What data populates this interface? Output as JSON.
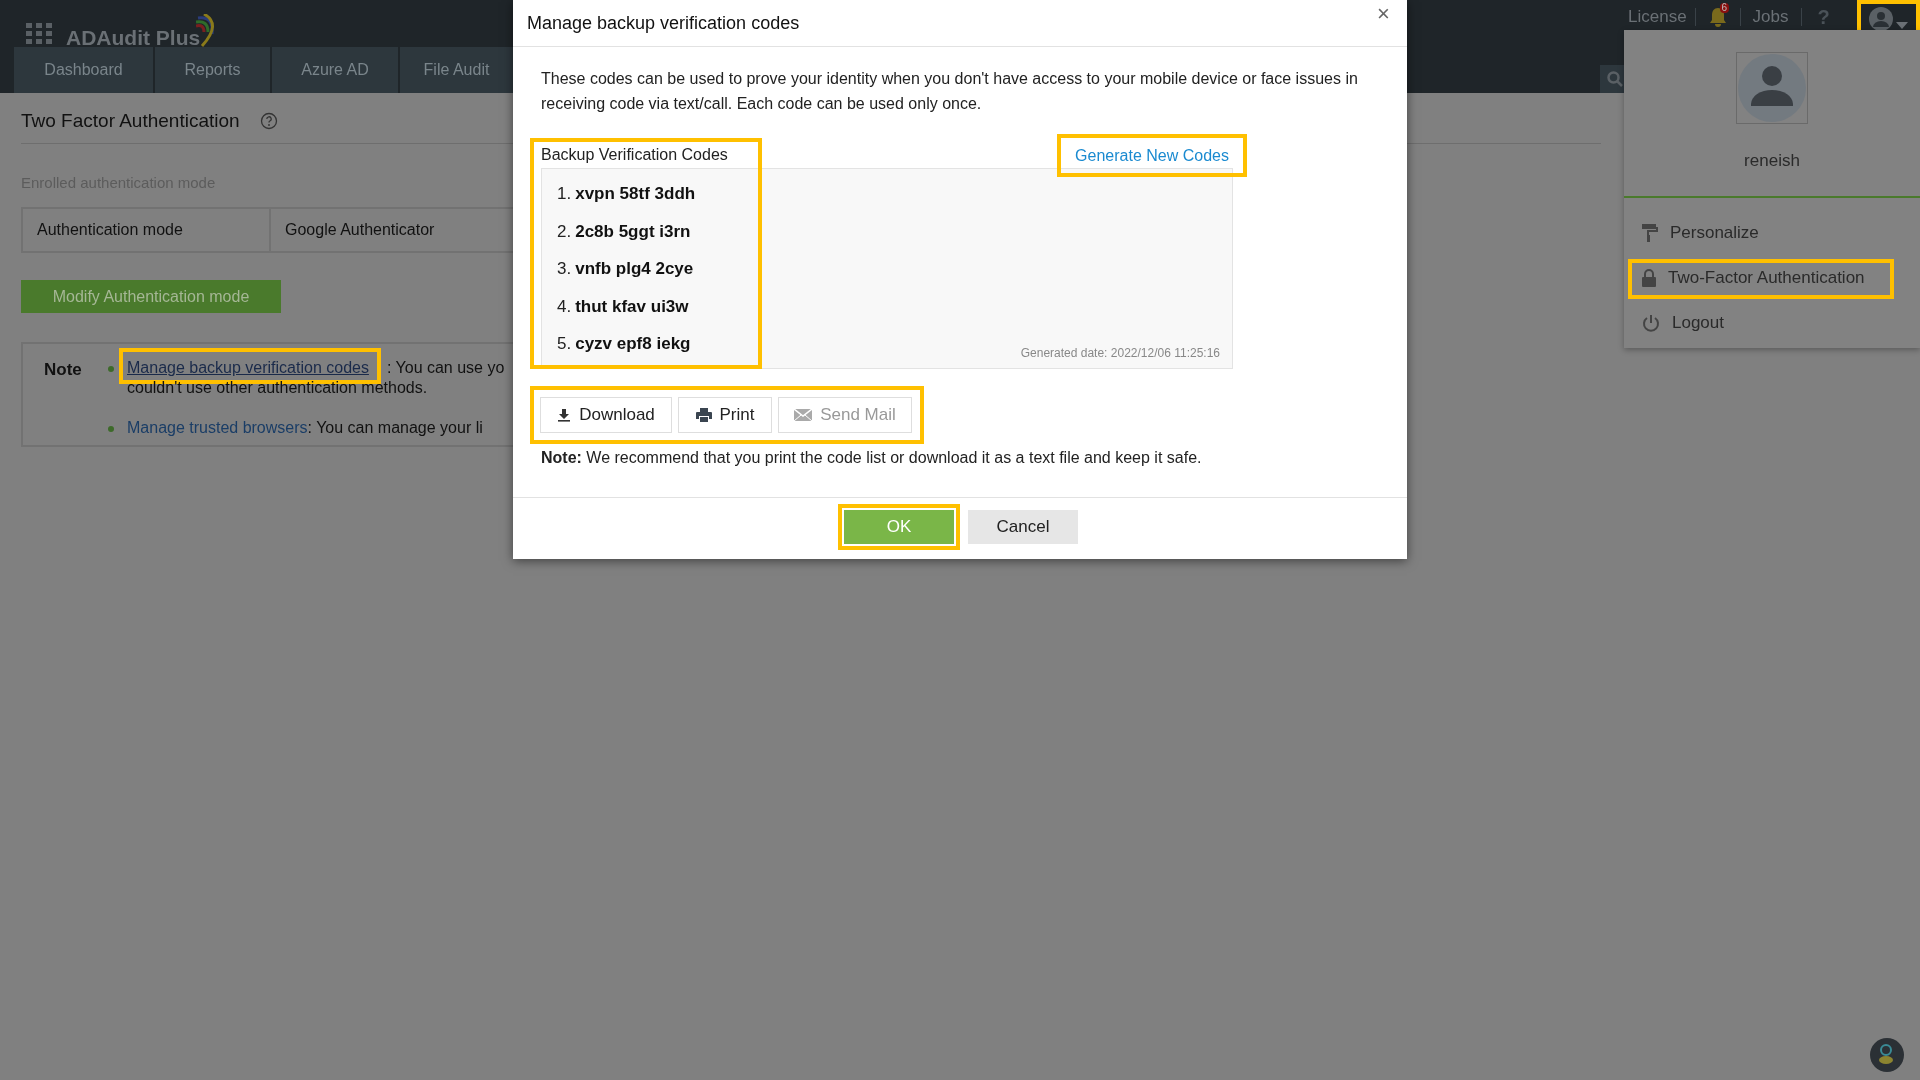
{
  "app": {
    "name": "ADAudit Plus"
  },
  "nav_tabs": [
    {
      "label": "Dashboard"
    },
    {
      "label": "Reports"
    },
    {
      "label": "Azure AD"
    },
    {
      "label": "File Audit"
    }
  ],
  "header": {
    "license": "License",
    "notification_count": "6",
    "jobs": "Jobs",
    "help": "?",
    "user_button_highlighted": true
  },
  "page": {
    "title": "Two Factor Authentication",
    "section_label": "Enrolled authentication mode",
    "table": {
      "rows": [
        [
          "Authentication mode",
          "Google Authenticator"
        ]
      ]
    },
    "modify_button": "Modify Authentication mode",
    "note": {
      "heading": "Note",
      "items": [
        {
          "link": "Manage backup verification codes",
          "highlighted": true,
          "text": ": You can use yo",
          "continuation": "couldn't use other authentication methods."
        },
        {
          "link": "Manage trusted browsers",
          "highlighted": false,
          "text": ": You can manage your li"
        }
      ]
    }
  },
  "dialog": {
    "title": "Manage backup verification codes",
    "close": "×",
    "description": "These codes can be used to prove your identity when you don't have access to your mobile device or face issues in receiving code via text/call. Each code can be used only once.",
    "codes_label": "Backup Verification Codes",
    "codes_highlighted": true,
    "generate_link": "Generate New Codes",
    "generate_highlighted": true,
    "codes": [
      {
        "number": "1.",
        "code": "xvpn 58tf 3ddh"
      },
      {
        "number": "2.",
        "code": "2c8b 5ggt i3rn"
      },
      {
        "number": "3.",
        "code": "vnfb plg4 2cye"
      },
      {
        "number": "4.",
        "code": "thut kfav ui3w"
      },
      {
        "number": "5.",
        "code": "cyzv epf8 iekg"
      }
    ],
    "generated_date": "Generated date: 2022/12/06 11:25:16",
    "actions_highlighted": true,
    "actions": [
      {
        "label": "Download",
        "kind": "download",
        "disabled": false
      },
      {
        "label": "Print",
        "kind": "print",
        "disabled": false
      },
      {
        "label": "Send Mail",
        "kind": "mail",
        "disabled": true
      }
    ],
    "note": "**Note:** We recommend that you print the code list or download it as a text file and keep it safe.",
    "footer_buttons": [
      {
        "label": "OK",
        "kind": "primary",
        "highlighted": true
      },
      {
        "label": "Cancel",
        "kind": "secondary",
        "highlighted": false
      }
    ]
  },
  "user_menu": {
    "username": "reneish",
    "items": [
      {
        "label": "Personalize",
        "kind": "personalize",
        "highlighted": false
      },
      {
        "label": "Two-Factor Authentication",
        "kind": "lock",
        "highlighted": true
      },
      {
        "label": "Logout",
        "kind": "logout",
        "highlighted": false
      }
    ]
  }
}
